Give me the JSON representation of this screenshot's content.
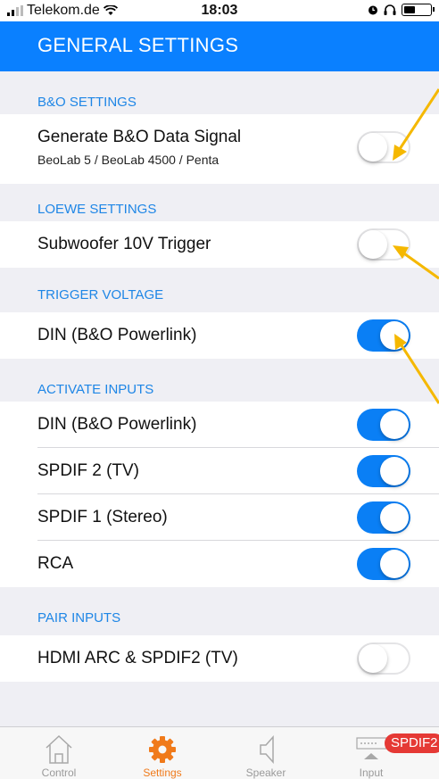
{
  "status_bar": {
    "carrier": "Telekom.de",
    "time": "18:03"
  },
  "header": {
    "title": "GENERAL SETTINGS"
  },
  "sections": [
    {
      "header": "B&O SETTINGS",
      "items": [
        {
          "label": "Generate B&O Data Signal",
          "sublabel": "BeoLab 5 / BeoLab 4500 / Penta",
          "on": false
        }
      ]
    },
    {
      "header": "LOEWE SETTINGS",
      "items": [
        {
          "label": "Subwoofer 10V Trigger",
          "on": false
        }
      ]
    },
    {
      "header": "TRIGGER VOLTAGE",
      "items": [
        {
          "label": "DIN (B&O Powerlink)",
          "on": true
        }
      ]
    },
    {
      "header": "ACTIVATE INPUTS",
      "items": [
        {
          "label": "DIN (B&O Powerlink)",
          "on": true
        },
        {
          "label": "SPDIF 2 (TV)",
          "on": true
        },
        {
          "label": "SPDIF 1 (Stereo)",
          "on": true
        },
        {
          "label": "RCA",
          "on": true
        }
      ]
    },
    {
      "header": "PAIR INPUTS",
      "items": [
        {
          "label": "HDMI ARC & SPDIF2 (TV)",
          "on": false
        }
      ]
    }
  ],
  "tabs": [
    {
      "label": "Control",
      "icon": "house-icon"
    },
    {
      "label": "Settings",
      "icon": "gear-icon",
      "active": true
    },
    {
      "label": "Speaker",
      "icon": "speaker-icon"
    },
    {
      "label": "Input",
      "icon": "input-icon"
    }
  ],
  "input_badge": "SPDIF2",
  "colors": {
    "accent": "#0a80ff",
    "toggle_on": "#0a7ff5",
    "section_header": "#1e86e6",
    "active_tab": "#f07a1a",
    "badge": "#e53935",
    "annotation_arrow": "#f5b800"
  }
}
